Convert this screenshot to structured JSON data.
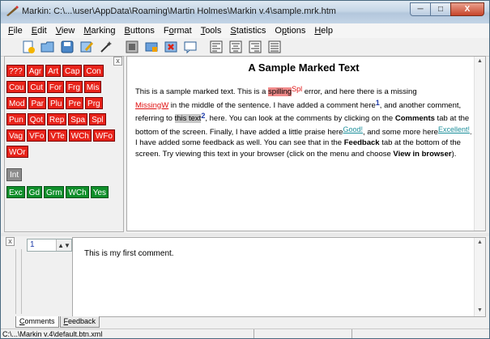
{
  "window": {
    "title": "Markin: C:\\...\\user\\AppData\\Roaming\\Martin Holmes\\Markin v.4\\sample.mrk.htm",
    "minimize": "─",
    "maximize": "□",
    "close": "X"
  },
  "menu": [
    {
      "label": "File",
      "underline": "F",
      "rest": "ile"
    },
    {
      "label": "Edit",
      "underline": "E",
      "rest": "dit"
    },
    {
      "label": "View",
      "underline": "V",
      "rest": "iew"
    },
    {
      "label": "Marking",
      "underline": "M",
      "rest": "arking"
    },
    {
      "label": "Buttons",
      "underline": "B",
      "rest": "uttons"
    },
    {
      "label": "Format",
      "pre": "F",
      "underline": "o",
      "rest": "rmat"
    },
    {
      "label": "Tools",
      "underline": "T",
      "rest": "ools"
    },
    {
      "label": "Statistics",
      "underline": "S",
      "rest": "tatistics"
    },
    {
      "label": "Options",
      "pre": "O",
      "underline": "p",
      "rest": "tions"
    },
    {
      "label": "Help",
      "underline": "H",
      "rest": "elp"
    }
  ],
  "toolbar": {
    "icons": [
      "new-file-icon",
      "open-folder-icon",
      "save-icon",
      "edit-note-icon",
      "magic-wand-icon",
      "image-icon",
      "tag-icon",
      "delete-mark-icon",
      "comment-icon",
      "align-left-icon",
      "align-center-icon",
      "align-right-icon",
      "justify-icon"
    ]
  },
  "tag_buttons": {
    "collapse_label": "x",
    "rows": [
      {
        "style": "red",
        "items": [
          "???",
          "Agr",
          "Art",
          "Cap",
          "Con"
        ]
      },
      {
        "style": "red",
        "items": [
          "Cou",
          "Cut",
          "For",
          "Frg",
          "Mis"
        ]
      },
      {
        "style": "red",
        "items": [
          "Mod",
          "Par",
          "Plu",
          "Pre",
          "Prg"
        ]
      },
      {
        "style": "red",
        "items": [
          "Pun",
          "Qot",
          "Rep",
          "Spa",
          "Spl"
        ]
      },
      {
        "style": "red",
        "items": [
          "Vag",
          "VFo",
          "VTe",
          "WCh",
          "WFo"
        ]
      },
      {
        "style": "red",
        "items": [
          "WOr"
        ]
      },
      {
        "style": "grey",
        "items": [
          "Int"
        ]
      },
      {
        "style": "green",
        "items": [
          "Exc",
          "Gd",
          "Grm",
          "WCh",
          "Yes"
        ]
      }
    ]
  },
  "document": {
    "title": "A Sample Marked Text",
    "p1": "This is a sample marked text. This is a ",
    "spilling": "spilling",
    "spl": "Spl",
    "p2": " error, and here there is a missing",
    "missing": "MissingW",
    "p3": " in the middle of the sentence. I have added a comment here",
    "sup1": "1",
    "p4": ", and another comment, referring to ",
    "this_text": "this text",
    "sup2": "2",
    "p5": ", here. You can look at the comments by clicking on the ",
    "comments_bold": "Comments",
    "p6": " tab at the bottom of the screen. Finally, I have added a little praise here",
    "good": "Good!",
    "p7": ", and some more here",
    "excellent": "Excellent!",
    "p8": ". I have added some feedback as well. You can see that in the ",
    "feedback_bold": "Feedback",
    "p9": " tab at the bottom of the screen. Try viewing this text in your browser (click on the  menu and choose ",
    "view_bold": "View in browser",
    "p10": ")."
  },
  "comment": {
    "collapse_label": "x",
    "number": "1",
    "text": "This is my first comment."
  },
  "tabs": [
    {
      "underline": "C",
      "rest": "omments",
      "active": true
    },
    {
      "underline": "F",
      "rest": "eedback",
      "active": false
    }
  ],
  "status": {
    "path": "C:\\...\\Markin v.4\\default.btn.xml"
  }
}
